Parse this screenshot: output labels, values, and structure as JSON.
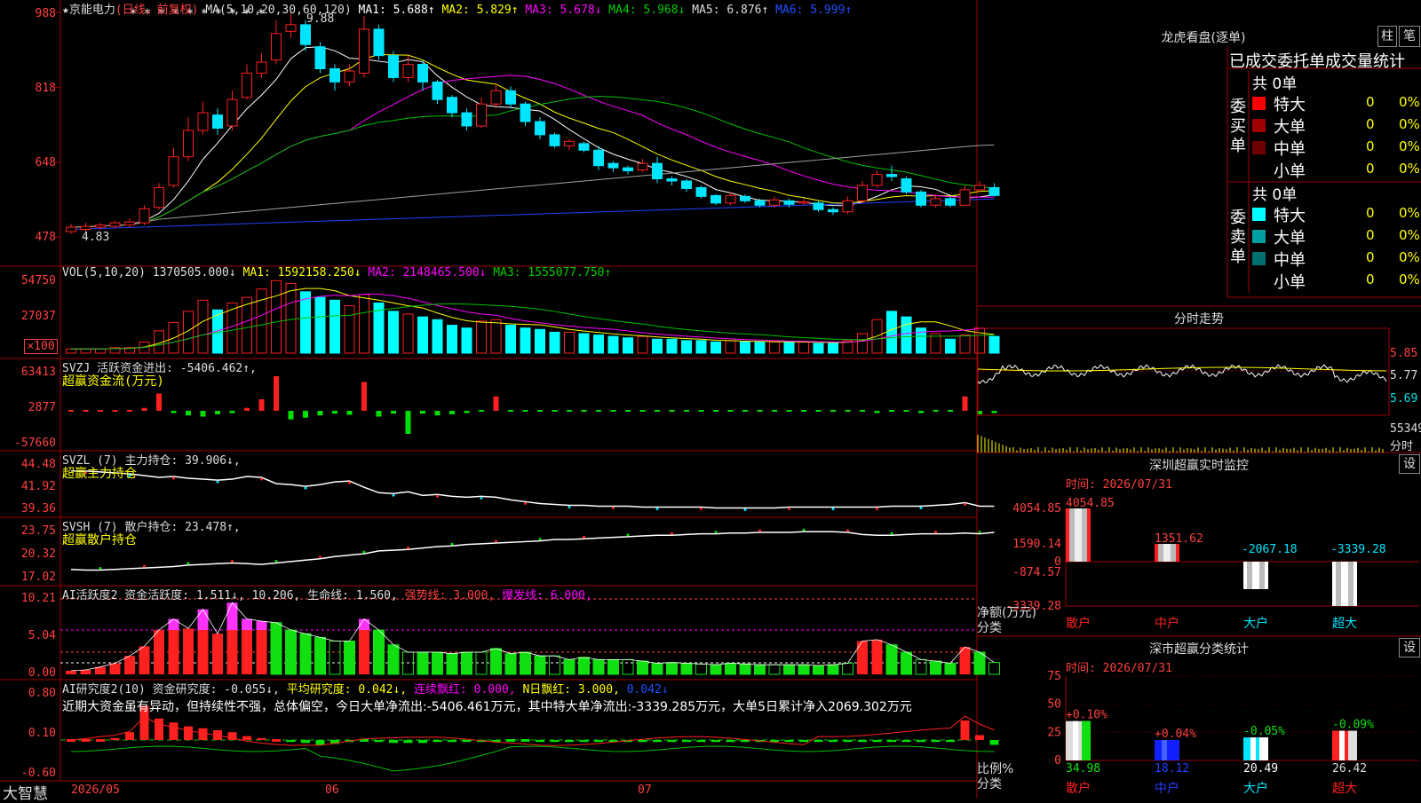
{
  "colors": {
    "up": "#ff2020",
    "down": "#00e5ff",
    "grid": "#a00000",
    "ma1": "#ffffff",
    "ma2": "#ffff00",
    "ma3": "#ff00ff",
    "ma4": "#00c000",
    "ma5": "#a0a0a0",
    "ma6": "#2040ff",
    "vol": "#00ffff"
  },
  "header": {
    "star": "★",
    "stock": "京能电力",
    "mode": "(日线，前复权)",
    "ma_params": "MA(5,10,20,30,60,120)",
    "ma1": "MA1: 5.688↑",
    "ma2": "MA2: 5.829↑",
    "ma3": "MA3: 5.678↓",
    "ma4": "MA4: 5.968↓",
    "ma5": "MA5: 6.876↑",
    "ma6": "MA6: 5.999↑",
    "high_mark": "9.88",
    "low_mark": "4.83"
  },
  "price_axis": {
    "ticks": [
      "988",
      "818",
      "648",
      "478"
    ]
  },
  "vol_header": {
    "name": "VOL(5,10,20)",
    "value": "1370505.000↓",
    "ma1": "MA1: 1592158.250↓",
    "ma2": "MA2: 2148465.500↓",
    "ma3": "MA3: 1555077.750↑"
  },
  "vol_axis": {
    "ticks": [
      "54750",
      "27037",
      "×100"
    ]
  },
  "svzj": {
    "title": "SVZJ  活跃资金进出: -5406.462↑,",
    "sub": "超赢资金流(万元)",
    "ticks": [
      "63413",
      "2877",
      "-57660"
    ]
  },
  "svzl": {
    "title": "SVZL (7) 主力持仓: 39.906↓,",
    "sub": "超赢主力持仓",
    "ticks": [
      "44.48",
      "41.92",
      "39.36"
    ]
  },
  "svsh": {
    "title": "SVSH (7) 散户持仓: 23.478↑,",
    "sub": "超赢散户持仓",
    "ticks": [
      "23.75",
      "20.32",
      "17.02"
    ]
  },
  "ai_act": {
    "title": "AI活跃度2 资金活跃度: 1.511↓, 10.206, 生命线: 1.560,",
    "strong": "强势线: 3.000,",
    "burst": "爆发线: 6.000,",
    "ticks": [
      "10.21",
      "5.04",
      "0.00"
    ]
  },
  "ai_res": {
    "title": "AI研究度2(10) 资金研究度: -0.055↓,",
    "avg": "平均研究度: 0.042↓,",
    "cont": "连续飘红: 0.000,",
    "n_red": "N日飘红: 3.000,",
    "val": "0.042↓",
    "desc": "近期大资金虽有异动，但持续性不强，总体偏空，今日大单净流出:-5406.461万元，其中特大单净流出:-3339.285万元，大单5日累计净入2069.302万元",
    "ticks": [
      "0.80",
      "0.10",
      "-0.60"
    ]
  },
  "date_axis": {
    "labels": [
      "2026/05",
      "06",
      "07"
    ]
  },
  "brand": "大智慧",
  "right": {
    "lhkp": {
      "title": "龙虎看盘(逐单)",
      "btn1": "柱",
      "btn2": "笔",
      "subtitle": "已成交委托单成交量统计",
      "buy": {
        "label": "委买单",
        "total": "共 0单",
        "rows": [
          {
            "name": "特大",
            "n": "0",
            "p": "0%",
            "color": "#ff0000"
          },
          {
            "name": "大单",
            "n": "0",
            "p": "0%",
            "color": "#a00000"
          },
          {
            "name": "中单",
            "n": "0",
            "p": "0%",
            "color": "#700000"
          },
          {
            "name": "小单",
            "n": "0",
            "p": "0%",
            "color": "#000000"
          }
        ]
      },
      "sell": {
        "label": "委卖单",
        "total": "共 0单",
        "rows": [
          {
            "name": "特大",
            "n": "0",
            "p": "0%",
            "color": "#00ffff"
          },
          {
            "name": "大单",
            "n": "0",
            "p": "0%",
            "color": "#00a0a0"
          },
          {
            "name": "中单",
            "n": "0",
            "p": "0%",
            "color": "#007070"
          },
          {
            "name": "小单",
            "n": "0",
            "p": "0%",
            "color": "#000000"
          }
        ]
      }
    },
    "fszs": {
      "title": "分时走势",
      "ticks": [
        "5.85",
        "5.77",
        "5.69"
      ],
      "vol": "55349",
      "vol_label": "分时"
    },
    "szjk": {
      "title": "深圳超赢实时监控",
      "btn": "设",
      "time": "时间: 2026/07/31",
      "yticks": [
        "4054.85",
        "1590.14",
        "0",
        "-874.57",
        "-3339.28"
      ],
      "ylabel": "净额(万元)",
      "xlabel": "分类"
    },
    "fltj": {
      "title": "深市超赢分类统计",
      "btn": "设",
      "time": "时间: 2026/07/31",
      "yticks": [
        "75",
        "50",
        "25",
        "0"
      ],
      "ylabel": "比例%",
      "xlabel": "分类"
    }
  },
  "chart_data": [
    {
      "type": "candlestick",
      "title": "京能电力 (日线，前复权)",
      "ylim": [
        4.78,
        9.88
      ],
      "candles": [
        [
          4.9,
          5.0,
          5.08,
          4.85
        ],
        [
          4.95,
          5.02,
          5.1,
          4.9
        ],
        [
          5.0,
          5.05,
          5.1,
          4.95
        ],
        [
          5.02,
          5.1,
          5.15,
          4.98
        ],
        [
          5.05,
          5.12,
          5.2,
          5.0
        ],
        [
          5.1,
          5.42,
          5.5,
          5.05
        ],
        [
          5.45,
          5.9,
          6.0,
          5.4
        ],
        [
          5.95,
          6.6,
          6.8,
          5.9
        ],
        [
          6.6,
          7.2,
          7.5,
          6.5
        ],
        [
          7.2,
          7.6,
          7.85,
          7.1
        ],
        [
          7.55,
          7.25,
          7.7,
          7.1
        ],
        [
          7.3,
          7.9,
          8.1,
          7.2
        ],
        [
          7.95,
          8.5,
          8.7,
          7.9
        ],
        [
          8.5,
          8.75,
          8.95,
          8.4
        ],
        [
          8.8,
          9.4,
          9.7,
          8.7
        ],
        [
          9.45,
          9.6,
          9.88,
          9.3
        ],
        [
          9.6,
          9.15,
          9.7,
          9.0
        ],
        [
          9.1,
          8.6,
          9.2,
          8.5
        ],
        [
          8.6,
          8.3,
          8.7,
          8.1
        ],
        [
          8.3,
          8.55,
          8.7,
          8.2
        ],
        [
          8.5,
          9.5,
          9.8,
          8.4
        ],
        [
          9.5,
          8.9,
          9.6,
          8.8
        ],
        [
          8.9,
          8.4,
          9.0,
          8.3
        ],
        [
          8.4,
          8.7,
          8.9,
          8.3
        ],
        [
          8.7,
          8.3,
          8.8,
          8.1
        ],
        [
          8.3,
          7.9,
          8.35,
          7.8
        ],
        [
          7.95,
          7.6,
          8.0,
          7.5
        ],
        [
          7.6,
          7.3,
          7.7,
          7.2
        ],
        [
          7.3,
          7.8,
          7.95,
          7.25
        ],
        [
          7.8,
          8.1,
          8.25,
          7.7
        ],
        [
          8.1,
          7.8,
          8.2,
          7.7
        ],
        [
          7.8,
          7.4,
          7.85,
          7.3
        ],
        [
          7.4,
          7.1,
          7.5,
          7.0
        ],
        [
          7.1,
          6.85,
          7.15,
          6.8
        ],
        [
          6.85,
          6.95,
          7.0,
          6.75
        ],
        [
          6.9,
          6.75,
          6.95,
          6.7
        ],
        [
          6.75,
          6.4,
          6.85,
          6.3
        ],
        [
          6.45,
          6.35,
          6.5,
          6.25
        ],
        [
          6.35,
          6.28,
          6.4,
          6.2
        ],
        [
          6.3,
          6.45,
          6.55,
          6.25
        ],
        [
          6.45,
          6.1,
          6.6,
          6.0
        ],
        [
          6.1,
          6.05,
          6.15,
          5.95
        ],
        [
          6.05,
          5.88,
          6.1,
          5.8
        ],
        [
          5.9,
          5.7,
          5.95,
          5.65
        ],
        [
          5.72,
          5.55,
          5.75,
          5.5
        ],
        [
          5.55,
          5.72,
          5.8,
          5.5
        ],
        [
          5.7,
          5.6,
          5.75,
          5.55
        ],
        [
          5.6,
          5.5,
          5.65,
          5.45
        ],
        [
          5.5,
          5.62,
          5.7,
          5.45
        ],
        [
          5.6,
          5.52,
          5.65,
          5.45
        ],
        [
          5.55,
          5.58,
          5.65,
          5.5
        ],
        [
          5.55,
          5.4,
          5.6,
          5.35
        ],
        [
          5.4,
          5.35,
          5.45,
          5.28
        ],
        [
          5.35,
          5.6,
          5.7,
          5.3
        ],
        [
          5.6,
          5.95,
          6.05,
          5.55
        ],
        [
          5.95,
          6.2,
          6.3,
          5.9
        ],
        [
          6.2,
          6.15,
          6.4,
          6.05
        ],
        [
          6.1,
          5.8,
          6.15,
          5.75
        ],
        [
          5.8,
          5.5,
          5.85,
          5.45
        ],
        [
          5.5,
          5.65,
          5.75,
          5.45
        ],
        [
          5.65,
          5.5,
          5.7,
          5.45
        ],
        [
          5.5,
          5.85,
          5.95,
          5.5
        ],
        [
          5.85,
          5.95,
          6.05,
          5.8
        ],
        [
          5.9,
          5.72,
          6.0,
          5.7
        ]
      ],
      "series": [
        {
          "name": "MA1",
          "value": 5.688
        },
        {
          "name": "MA2",
          "value": 5.829
        },
        {
          "name": "MA3",
          "value": 5.678
        },
        {
          "name": "MA4",
          "value": 5.968
        },
        {
          "name": "MA5",
          "value": 6.876
        },
        {
          "name": "MA6",
          "value": 5.999
        }
      ]
    },
    {
      "type": "bar",
      "title": "VOL(5,10,20)",
      "ylim": [
        0,
        54750
      ],
      "values": [
        3,
        3,
        3,
        4,
        4,
        8,
        16,
        22,
        30,
        38,
        31,
        36,
        40,
        46,
        52,
        50,
        44,
        40,
        38,
        34,
        42,
        36,
        30,
        28,
        26,
        24,
        20,
        18,
        23,
        24,
        20,
        18,
        17,
        15,
        15,
        14,
        13,
        12,
        11,
        12,
        10,
        10,
        9,
        9,
        8,
        9,
        8,
        8,
        8,
        8,
        8,
        7,
        7,
        9,
        14,
        24,
        30,
        26,
        18,
        14,
        10,
        13,
        18,
        12
      ]
    },
    {
      "type": "bar",
      "title": "SVZJ 超赢资金流(万元)",
      "ylim": [
        -57660,
        63413
      ],
      "values": [
        0,
        0,
        0,
        0,
        2,
        5,
        30,
        -4,
        -8,
        -10,
        -6,
        -4,
        5,
        20,
        60,
        -15,
        -12,
        -8,
        -5,
        -7,
        50,
        -10,
        -5,
        -40,
        -5,
        -8,
        -6,
        -4,
        -3,
        25,
        -2,
        -2,
        -2,
        -2,
        -2,
        -3,
        -3,
        -2,
        -2,
        -2,
        -2,
        -2,
        -2,
        -3,
        -2,
        -2,
        -2,
        -3,
        -2,
        -2,
        -3,
        -2,
        -2,
        -3,
        -3,
        -4,
        -3,
        -3,
        -4,
        -3,
        -3,
        25,
        -6,
        -4
      ]
    },
    {
      "type": "line",
      "title": "SVZL 超赢主力持仓",
      "ylim": [
        39.36,
        44.48
      ],
      "values": [
        43.8,
        43.8,
        43.7,
        43.6,
        43.5,
        43.3,
        43.1,
        43.2,
        43.0,
        42.9,
        42.8,
        42.9,
        43.2,
        43.1,
        42.4,
        42.3,
        42.1,
        42.3,
        42.6,
        42.7,
        42.0,
        41.4,
        41.3,
        41.5,
        41.1,
        41.2,
        41.0,
        40.9,
        41.0,
        40.9,
        40.6,
        40.4,
        40.2,
        40.1,
        40.0,
        40.0,
        39.9,
        39.9,
        39.9,
        39.8,
        39.8,
        39.8,
        39.8,
        39.8,
        39.7,
        39.7,
        39.7,
        39.7,
        39.7,
        39.8,
        39.8,
        39.8,
        39.8,
        39.8,
        39.8,
        39.8,
        39.9,
        39.9,
        39.9,
        40.0,
        40.1,
        40.3,
        39.9,
        39.9
      ]
    },
    {
      "type": "line",
      "title": "SVSH 超赢散户持仓",
      "ylim": [
        17.02,
        23.75
      ],
      "values": [
        18.3,
        18.2,
        18.2,
        18.3,
        18.4,
        18.5,
        18.6,
        18.7,
        18.9,
        19.0,
        19.1,
        19.2,
        19.1,
        19.0,
        19.2,
        19.4,
        19.6,
        19.8,
        20.1,
        20.3,
        20.5,
        20.9,
        21.0,
        21.1,
        21.3,
        21.5,
        21.6,
        21.8,
        21.9,
        22.0,
        22.1,
        22.2,
        22.3,
        22.5,
        22.5,
        22.6,
        22.7,
        22.8,
        22.9,
        23.0,
        23.1,
        23.1,
        23.2,
        23.3,
        23.3,
        23.4,
        23.4,
        23.5,
        23.5,
        23.5,
        23.6,
        23.6,
        23.6,
        23.5,
        23.2,
        23.1,
        23.1,
        23.2,
        23.3,
        23.3,
        23.3,
        23.4,
        23.3,
        23.5
      ]
    },
    {
      "type": "bar",
      "title": "AI活跃度2",
      "ylim": [
        0,
        10.21
      ],
      "values": [
        0.5,
        0.6,
        1.0,
        1.5,
        2.5,
        3.8,
        6.0,
        7.5,
        6.2,
        8.8,
        5.5,
        9.7,
        7.5,
        7.2,
        7.0,
        6.0,
        5.5,
        5.0,
        4.5,
        4.5,
        7.5,
        6.0,
        4.0,
        3.0,
        3.0,
        3.0,
        2.8,
        3.0,
        3.0,
        3.5,
        2.8,
        3.0,
        2.5,
        2.5,
        2.0,
        2.3,
        2.0,
        2.0,
        2.0,
        1.8,
        1.5,
        1.6,
        1.5,
        1.4,
        1.3,
        1.5,
        1.4,
        1.3,
        1.3,
        1.3,
        1.3,
        1.2,
        1.3,
        1.5,
        4.5,
        4.7,
        4.0,
        3.0,
        2.0,
        1.8,
        1.5,
        3.7,
        3.0,
        1.6
      ],
      "colors": [
        "u",
        "u",
        "u",
        "u",
        "u",
        "u",
        "m",
        "m",
        "u",
        "m",
        "u",
        "m",
        "m",
        "m",
        "g",
        "g",
        "g",
        "g",
        "g",
        "g",
        "m",
        "g",
        "g",
        "g",
        "g",
        "g",
        "g",
        "g",
        "g",
        "g",
        "g",
        "g",
        "g",
        "g",
        "g",
        "g",
        "g",
        "g",
        "g",
        "g",
        "g",
        "g",
        "g",
        "g",
        "g",
        "g",
        "g",
        "g",
        "g",
        "g",
        "g",
        "g",
        "g",
        "g",
        "u",
        "u",
        "g",
        "g",
        "g",
        "g",
        "g",
        "u",
        "g",
        "g"
      ]
    },
    {
      "type": "bar",
      "title": "AI研究度2(10)",
      "ylim": [
        -0.6,
        0.8
      ],
      "values": [
        0,
        0,
        0.01,
        0.02,
        0.08,
        0.35,
        0.22,
        0.18,
        0.14,
        0.12,
        0.1,
        0.08,
        0.04,
        0.02,
        0.0,
        -0.02,
        -0.03,
        -0.05,
        -0.04,
        -0.02,
        -0.01,
        -0.02,
        -0.03,
        -0.03,
        -0.03,
        -0.02,
        -0.02,
        -0.02,
        -0.02,
        -0.02,
        -0.01,
        -0.01,
        -0.02,
        -0.02,
        -0.02,
        -0.02,
        -0.02,
        -0.02,
        -0.02,
        -0.02,
        -0.02,
        -0.02,
        -0.02,
        -0.02,
        -0.02,
        -0.02,
        -0.02,
        -0.02,
        -0.02,
        -0.02,
        -0.02,
        -0.02,
        -0.02,
        -0.02,
        -0.02,
        -0.02,
        -0.02,
        -0.02,
        -0.02,
        -0.02,
        -0.02,
        0.2,
        0.05,
        -0.05
      ]
    },
    {
      "type": "bar",
      "title": "深圳超赢实时监控",
      "categories": [
        "散户",
        "中户",
        "大户",
        "超大"
      ],
      "values": [
        4054.85,
        1351.62,
        -2067.18,
        -3339.28
      ]
    },
    {
      "type": "bar",
      "title": "深市超赢分类统计",
      "categories": [
        "散户",
        "中户",
        "大户",
        "超大"
      ],
      "values": [
        34.98,
        18.12,
        20.49,
        26.42
      ],
      "changes": [
        "+0.10%",
        "+0.04%",
        "-0.05%",
        "-0.09%"
      ]
    }
  ]
}
